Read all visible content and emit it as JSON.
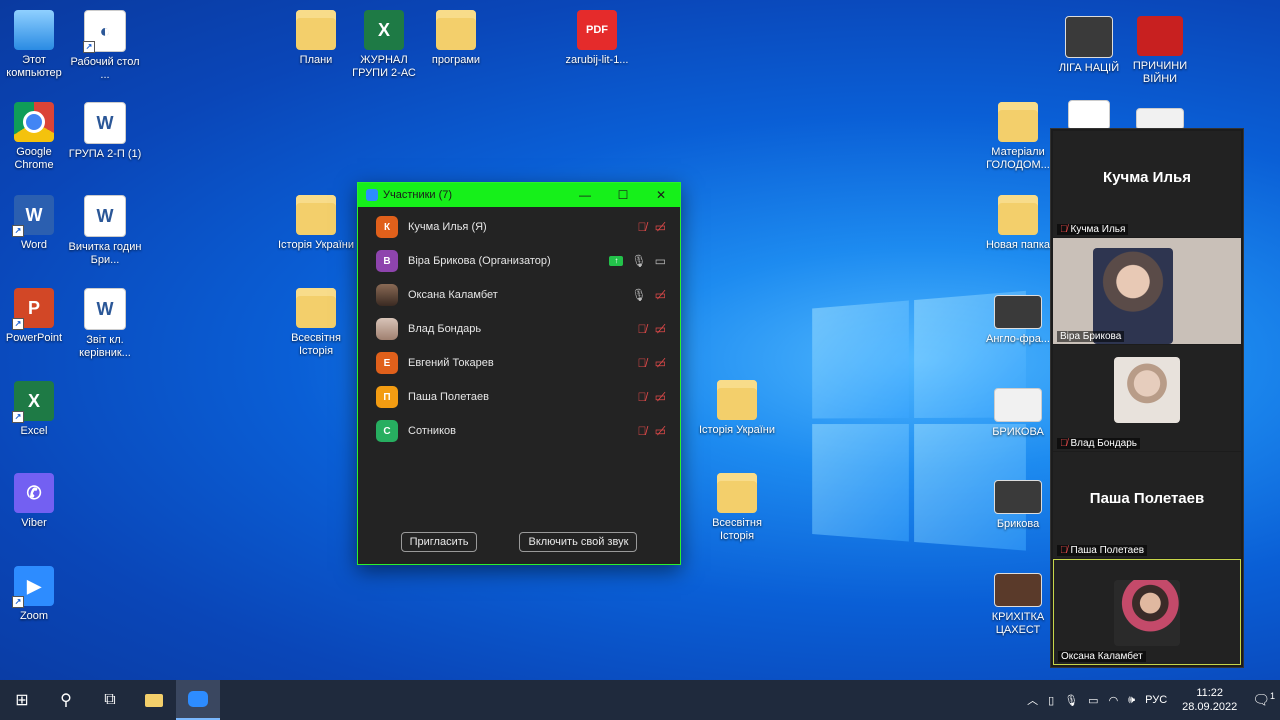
{
  "desktop_icons": [
    {
      "label": "Этот компьютер",
      "icon": "computer-icon"
    },
    {
      "label": "Рабочий стол ...",
      "icon": "shortcut-icon"
    },
    {
      "label": "Google Chrome",
      "icon": "chrome-icon"
    },
    {
      "label": "ГРУПА 2-П (1)",
      "icon": "word-icon"
    },
    {
      "label": "Word",
      "icon": "word-icon"
    },
    {
      "label": "Вичитка годин Бри...",
      "icon": "word-icon"
    },
    {
      "label": "PowerPoint",
      "icon": "powerpoint-icon"
    },
    {
      "label": "Звіт кл. керівник...",
      "icon": "word-icon"
    },
    {
      "label": "Excel",
      "icon": "excel-icon"
    },
    {
      "label": "Viber",
      "icon": "viber-icon"
    },
    {
      "label": "Zoom",
      "icon": "zoom-icon"
    },
    {
      "label": "Плани",
      "icon": "folder-icon"
    },
    {
      "label": "ЖУРНАЛ ГРУПИ 2-АС",
      "icon": "excel-icon"
    },
    {
      "label": "програми",
      "icon": "folder-icon"
    },
    {
      "label": "zarubij-lit-1...",
      "icon": "pdf-icon"
    },
    {
      "label": "Історія України",
      "icon": "folder-icon"
    },
    {
      "label": "Всесвітня Історія",
      "icon": "folder-icon"
    },
    {
      "label": "Історія України",
      "icon": "folder-icon"
    },
    {
      "label": "Всесвітня Історія",
      "icon": "folder-icon"
    },
    {
      "label": "ЛІГА НАЦІЙ",
      "icon": "powerpoint-icon"
    },
    {
      "label": "ПРИЧИНИ ВІЙНИ",
      "icon": "powerpoint-icon"
    },
    {
      "label": "Матеріали ГОЛОДОМ...",
      "icon": "folder-icon"
    },
    {
      "label": "Новая папка",
      "icon": "folder-icon"
    },
    {
      "label": "Англо-фра...",
      "icon": "powerpoint-icon"
    },
    {
      "label": "БРИКОВА",
      "icon": "powerpoint-icon"
    },
    {
      "label": "Брикова",
      "icon": "powerpoint-icon"
    },
    {
      "label": "КРИХІТКА ЦАХЕСТ",
      "icon": "powerpoint-icon"
    },
    {
      "label": "",
      "icon": "document-icon"
    },
    {
      "label": "",
      "icon": "document-icon"
    }
  ],
  "participants_window": {
    "title": "Участники (7)",
    "participants": [
      {
        "initial": "К",
        "name": "Кучма Илья (Я)",
        "color": "#e0601b",
        "mic": "off",
        "video": "off"
      },
      {
        "initial": "В",
        "name": "Віра Брикова (Организатор)",
        "color": "#8e44ad",
        "mic": "on",
        "video": "on",
        "sharing": true
      },
      {
        "initial": "",
        "name": "Оксана Каламбет",
        "color": "#5a4030",
        "mic": "on",
        "video": "off",
        "photo": true
      },
      {
        "initial": "",
        "name": "Влад Бондарь",
        "color": "#a08070",
        "mic": "off",
        "video": "off",
        "photo": true
      },
      {
        "initial": "Е",
        "name": "Евгений Токарев",
        "color": "#e0601b",
        "mic": "off",
        "video": "off"
      },
      {
        "initial": "П",
        "name": "Паша Полетаев",
        "color": "#f39c12",
        "mic": "off",
        "video": "off"
      },
      {
        "initial": "С",
        "name": "Сотников",
        "color": "#27ae60",
        "mic": "off",
        "video": "off"
      }
    ],
    "invite_label": "Пригласить",
    "unmute_label": "Включить свой звук"
  },
  "gallery": [
    {
      "big_name": "Кучма Илья",
      "label": "Кучма Илья",
      "muted": true,
      "video": false
    },
    {
      "big_name": "",
      "label": "Віра Брикова",
      "muted": false,
      "video": true
    },
    {
      "big_name": "",
      "label": "Влад Бондарь",
      "muted": true,
      "video": true
    },
    {
      "big_name": "Паша Полетаев",
      "label": "Паша Полетаев",
      "muted": true,
      "video": false
    },
    {
      "big_name": "",
      "label": "Оксана Каламбет",
      "muted": false,
      "video": true
    }
  ],
  "taskbar": {
    "language": "РУС",
    "time": "11:22",
    "date": "28.09.2022",
    "notification_count": "1"
  }
}
